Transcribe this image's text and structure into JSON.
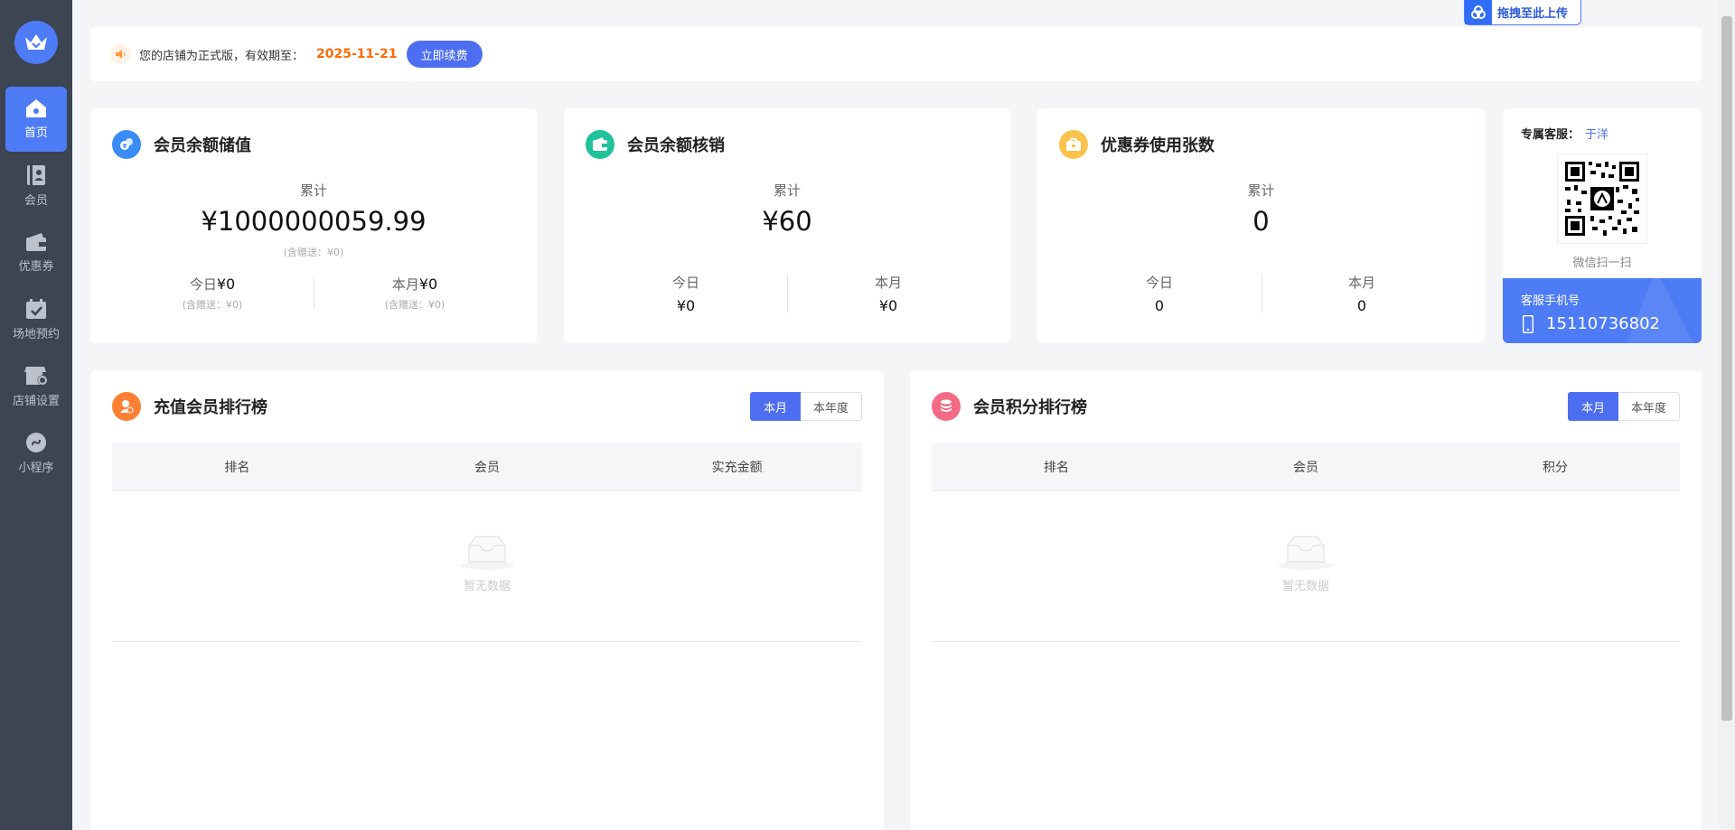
{
  "sidebar": {
    "items": [
      {
        "label": "首页",
        "icon": "home-icon"
      },
      {
        "label": "会员",
        "icon": "member-icon"
      },
      {
        "label": "优惠券",
        "icon": "coupon-icon"
      },
      {
        "label": "场地预约",
        "icon": "calendar-icon"
      },
      {
        "label": "店铺设置",
        "icon": "store-settings-icon"
      },
      {
        "label": "小程序",
        "icon": "mini-program-icon"
      }
    ]
  },
  "upload": {
    "label": "拖拽至此上传"
  },
  "notice": {
    "text": "您的店铺为正式版，有效期至：",
    "date": "2025-11-21",
    "renew": "立即续费"
  },
  "stats": [
    {
      "title": "会员余额储值",
      "total_label": "累计",
      "total": "¥1000000059.99",
      "total_note": "(含赠送：¥0)",
      "today_label": "今日",
      "today": "¥0",
      "today_note": "(含赠送：¥0)",
      "month_label": "本月",
      "month": "¥0",
      "month_note": "(含赠送：¥0)"
    },
    {
      "title": "会员余额核销",
      "total_label": "累计",
      "total": "¥60",
      "today_label": "今日",
      "today": "¥0",
      "month_label": "本月",
      "month": "¥0"
    },
    {
      "title": "优惠券使用张数",
      "total_label": "累计",
      "total": "0",
      "today_label": "今日",
      "today": "0",
      "month_label": "本月",
      "month": "0"
    }
  ],
  "service": {
    "label": "专属客服：",
    "name": "于洋",
    "qr_caption": "微信扫一扫",
    "phone_label": "客服手机号",
    "phone": "15110736802"
  },
  "rankings": [
    {
      "title": "充值会员排行榜",
      "tabs": [
        "本月",
        "本年度"
      ],
      "columns": [
        "排名",
        "会员",
        "实充金额"
      ],
      "empty": "暂无数据"
    },
    {
      "title": "会员积分排行榜",
      "tabs": [
        "本月",
        "本年度"
      ],
      "columns": [
        "排名",
        "会员",
        "积分"
      ],
      "empty": "暂无数据"
    }
  ],
  "colors": {
    "accent": "#4e6ef2",
    "sidebar": "#3d4452",
    "date": "#ff6a00"
  }
}
